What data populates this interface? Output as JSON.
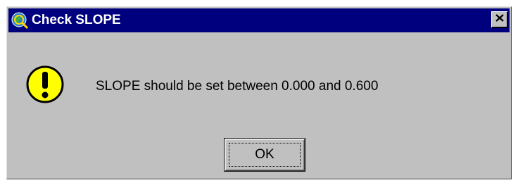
{
  "window": {
    "title": "Check SLOPE",
    "app_icon": "globe-magnifier-icon",
    "close_icon": "close-icon",
    "titlebar_color": "#00007f"
  },
  "dialog": {
    "icon": "exclamation-warning-icon",
    "message": "SLOPE should be set between 0.000 and 0.600",
    "ok_label": "OK",
    "background": "#c0c0c0"
  }
}
